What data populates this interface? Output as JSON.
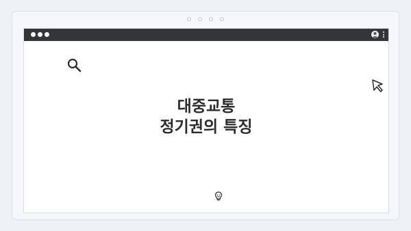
{
  "page": {
    "title_line1": "대중교통",
    "title_line2": "정기권의 특징"
  },
  "icons": {
    "search": "search-icon",
    "cursor": "cursor-icon",
    "bulb": "lightbulb-icon",
    "profile": "profile-icon",
    "menu": "kebab-menu-icon"
  },
  "colors": {
    "titlebar": "#333538",
    "text": "#2b2b2b",
    "background": "#eef1f5"
  }
}
